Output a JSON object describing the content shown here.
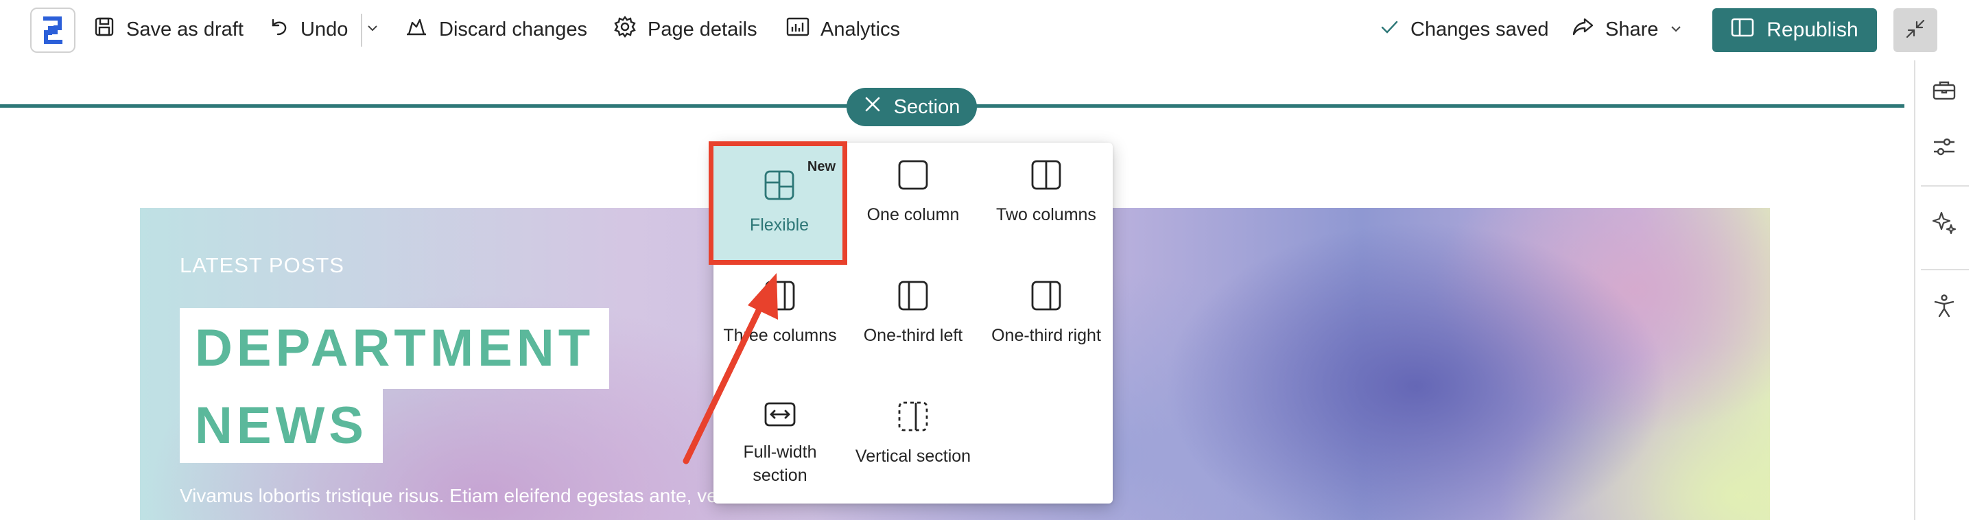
{
  "toolbar": {
    "save_draft_label": "Save as draft",
    "undo_label": "Undo",
    "discard_label": "Discard changes",
    "page_details_label": "Page details",
    "analytics_label": "Analytics",
    "status_label": "Changes saved",
    "share_label": "Share",
    "republish_label": "Republish"
  },
  "section_toolbar": {
    "label": "Section"
  },
  "layout_menu": {
    "options": [
      {
        "id": "flexible",
        "label": "Flexible",
        "badge": "New",
        "selected": true
      },
      {
        "id": "one-column",
        "label": "One column"
      },
      {
        "id": "two-columns",
        "label": "Two columns"
      },
      {
        "id": "three-columns",
        "label": "Three columns"
      },
      {
        "id": "one-third-left",
        "label": "One-third left"
      },
      {
        "id": "one-third-right",
        "label": "One-third right"
      },
      {
        "id": "full-width",
        "label_line1": "Full-width",
        "label_line2": "section"
      },
      {
        "id": "vertical-section",
        "label": "Vertical section"
      }
    ]
  },
  "hero": {
    "kicker": "LATEST POSTS",
    "title_line1": "DEPARTMENT",
    "title_line2": "NEWS",
    "body": "Vivamus lobortis tristique risus. Etiam eleifend egestas ante, ve"
  },
  "colors": {
    "accent": "#2d7777",
    "title_green": "#5bb89b",
    "annotation_red": "#e8412c",
    "selected_bg": "#c9e8e8"
  },
  "icons": {
    "logo": "sharepoint-logo-icon",
    "save": "save-icon",
    "undo": "undo-icon",
    "discard": "discard-icon",
    "page_details": "gear-icon",
    "analytics": "chart-icon",
    "status": "checkmark-icon",
    "share": "share-icon",
    "republish": "book-open-icon",
    "collapse": "collapse-icon",
    "rail": [
      "toolbox-icon",
      "sliders-icon",
      "sparkle-icon",
      "accessibility-icon"
    ]
  }
}
